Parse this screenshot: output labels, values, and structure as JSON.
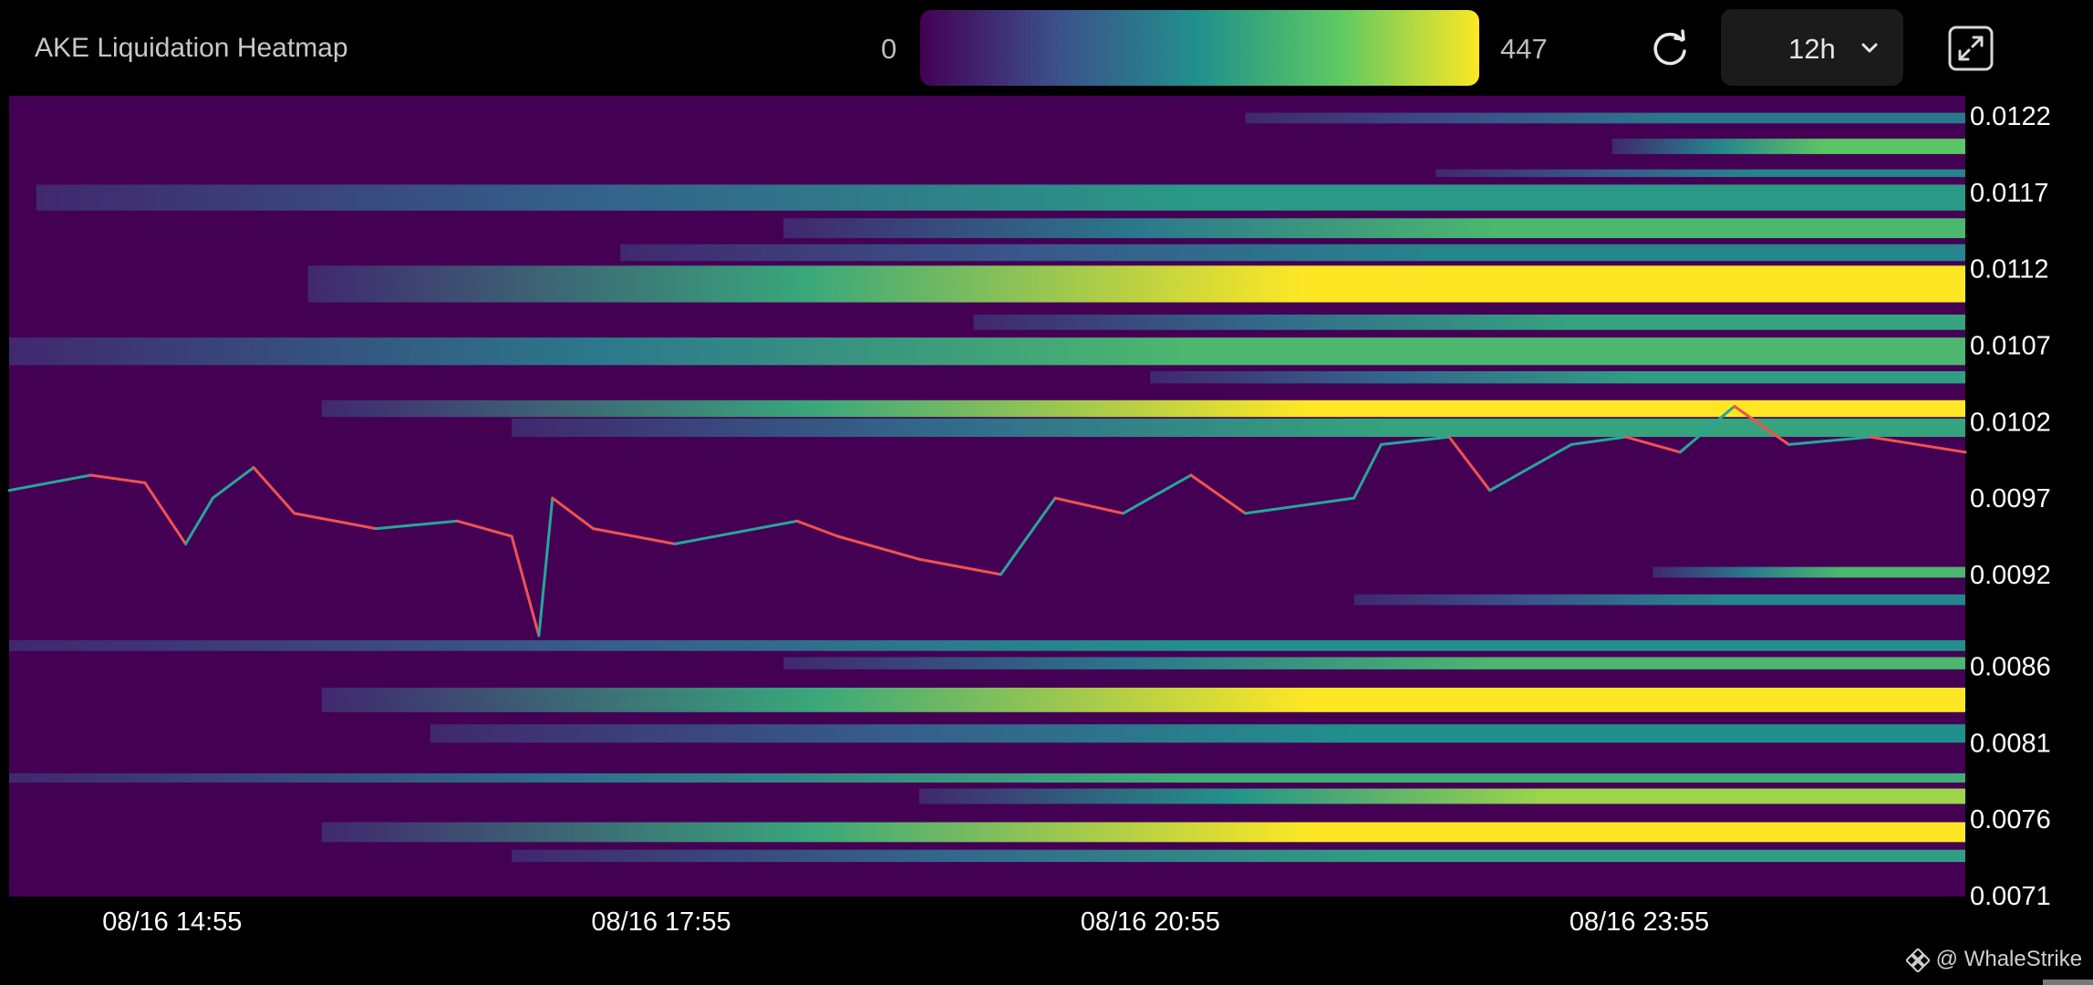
{
  "header": {
    "title": "AKE Liquidation Heatmap",
    "scale_min": "0",
    "scale_max": "447",
    "timeframe": "12h"
  },
  "icons": {
    "refresh": "refresh-icon",
    "chevron": "chevron-down-icon",
    "expand": "expand-icon",
    "brand": "binance-logo-icon"
  },
  "watermark": "@ WhaleStrike",
  "colors": {
    "background": "#000000",
    "heatmap_base": "#440154",
    "scale": [
      "#440154",
      "#3b528b",
      "#21918c",
      "#5ec962",
      "#fde725"
    ],
    "candle_up": "#26a69a",
    "candle_down": "#ef5350"
  },
  "chart_data": {
    "type": "heatmap",
    "title": "AKE Liquidation Heatmap",
    "x_ticks": [
      "08/16 14:55",
      "08/16 17:55",
      "08/16 20:55",
      "08/16 23:55"
    ],
    "x_range": [
      "08/16 13:55",
      "08/17 01:55"
    ],
    "y_ticks": [
      "0.0122",
      "0.0117",
      "0.0112",
      "0.0107",
      "0.0102",
      "0.0097",
      "0.0092",
      "0.0086",
      "0.0081",
      "0.0076",
      "0.0071"
    ],
    "ylim": [
      0.0071,
      0.0122
    ],
    "color_range": [
      0,
      447
    ],
    "price_path": [
      {
        "t": "08/16 13:55",
        "p": 0.00975
      },
      {
        "t": "08/16 14:25",
        "p": 0.00985
      },
      {
        "t": "08/16 14:45",
        "p": 0.0098
      },
      {
        "t": "08/16 15:00",
        "p": 0.0094
      },
      {
        "t": "08/16 15:10",
        "p": 0.0097
      },
      {
        "t": "08/16 15:25",
        "p": 0.0099
      },
      {
        "t": "08/16 15:40",
        "p": 0.0096
      },
      {
        "t": "08/16 16:10",
        "p": 0.0095
      },
      {
        "t": "08/16 16:40",
        "p": 0.00955
      },
      {
        "t": "08/16 17:00",
        "p": 0.00945
      },
      {
        "t": "08/16 17:10",
        "p": 0.0088
      },
      {
        "t": "08/16 17:15",
        "p": 0.0097
      },
      {
        "t": "08/16 17:30",
        "p": 0.0095
      },
      {
        "t": "08/16 18:00",
        "p": 0.0094
      },
      {
        "t": "08/16 18:45",
        "p": 0.00955
      },
      {
        "t": "08/16 19:00",
        "p": 0.00945
      },
      {
        "t": "08/16 19:30",
        "p": 0.0093
      },
      {
        "t": "08/16 20:00",
        "p": 0.0092
      },
      {
        "t": "08/16 20:20",
        "p": 0.0097
      },
      {
        "t": "08/16 20:45",
        "p": 0.0096
      },
      {
        "t": "08/16 21:10",
        "p": 0.00985
      },
      {
        "t": "08/16 21:30",
        "p": 0.0096
      },
      {
        "t": "08/16 22:10",
        "p": 0.0097
      },
      {
        "t": "08/16 22:20",
        "p": 0.01005
      },
      {
        "t": "08/16 22:45",
        "p": 0.0101
      },
      {
        "t": "08/16 23:00",
        "p": 0.00975
      },
      {
        "t": "08/16 23:30",
        "p": 0.01005
      },
      {
        "t": "08/16 23:50",
        "p": 0.0101
      },
      {
        "t": "08/17 00:10",
        "p": 0.01
      },
      {
        "t": "08/17 00:30",
        "p": 0.0103
      },
      {
        "t": "08/17 00:50",
        "p": 0.01005
      },
      {
        "t": "08/17 01:20",
        "p": 0.0101
      },
      {
        "t": "08/17 01:55",
        "p": 0.01
      }
    ],
    "liquidation_bands": [
      {
        "price_low": 0.01215,
        "price_high": 0.01222,
        "start": "08/16 21:30",
        "intensity": 180
      },
      {
        "price_low": 0.01195,
        "price_high": 0.01205,
        "start": "08/16 23:45",
        "intensity": 330
      },
      {
        "price_low": 0.0118,
        "price_high": 0.01185,
        "start": "08/16 22:40",
        "intensity": 200
      },
      {
        "price_low": 0.01158,
        "price_high": 0.01175,
        "start": "08/16 14:05",
        "intensity": 240
      },
      {
        "price_low": 0.0114,
        "price_high": 0.01153,
        "start": "08/16 18:40",
        "intensity": 300
      },
      {
        "price_low": 0.01125,
        "price_high": 0.01136,
        "start": "08/16 17:40",
        "intensity": 200
      },
      {
        "price_low": 0.01098,
        "price_high": 0.01122,
        "start": "08/16 15:45",
        "intensity": 447
      },
      {
        "price_low": 0.0108,
        "price_high": 0.0109,
        "start": "08/16 19:50",
        "intensity": 260
      },
      {
        "price_low": 0.01057,
        "price_high": 0.01075,
        "start": "08/16 13:55",
        "intensity": 300
      },
      {
        "price_low": 0.01045,
        "price_high": 0.01053,
        "start": "08/16 20:55",
        "intensity": 250
      },
      {
        "price_low": 0.01023,
        "price_high": 0.01034,
        "start": "08/16 15:50",
        "intensity": 447
      },
      {
        "price_low": 0.0101,
        "price_high": 0.01022,
        "start": "08/16 17:00",
        "intensity": 260
      },
      {
        "price_low": 0.00918,
        "price_high": 0.00925,
        "start": "08/17 00:00",
        "intensity": 300
      },
      {
        "price_low": 0.009,
        "price_high": 0.00907,
        "start": "08/16 22:10",
        "intensity": 200
      },
      {
        "price_low": 0.0087,
        "price_high": 0.00877,
        "start": "08/16 13:55",
        "intensity": 220
      },
      {
        "price_low": 0.00858,
        "price_high": 0.00866,
        "start": "08/16 18:40",
        "intensity": 300
      },
      {
        "price_low": 0.0083,
        "price_high": 0.00846,
        "start": "08/16 15:50",
        "intensity": 447
      },
      {
        "price_low": 0.0081,
        "price_high": 0.00822,
        "start": "08/16 16:30",
        "intensity": 220
      },
      {
        "price_low": 0.00784,
        "price_high": 0.0079,
        "start": "08/16 13:55",
        "intensity": 280
      },
      {
        "price_low": 0.0077,
        "price_high": 0.0078,
        "start": "08/16 19:30",
        "intensity": 380
      },
      {
        "price_low": 0.00745,
        "price_high": 0.00758,
        "start": "08/16 15:50",
        "intensity": 447
      },
      {
        "price_low": 0.00732,
        "price_high": 0.0074,
        "start": "08/16 17:00",
        "intensity": 250
      }
    ]
  }
}
